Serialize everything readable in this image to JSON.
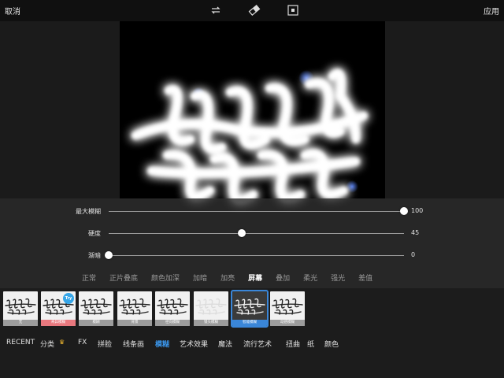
{
  "topbar": {
    "cancel": "取消",
    "apply": "应用",
    "icons": [
      "swap-icon",
      "eraser-icon",
      "compare-icon"
    ]
  },
  "sliders": [
    {
      "label": "最大模糊",
      "value": "100",
      "fraction": 1.0
    },
    {
      "label": "硬度",
      "value": "45",
      "fraction": 0.45
    },
    {
      "label": "渐暗",
      "value": "0",
      "fraction": 0.0
    }
  ],
  "blend_modes": [
    "正常",
    "正片叠底",
    "颜色加深",
    "加暗",
    "加亮",
    "屏幕",
    "叠加",
    "柔光",
    "强光",
    "差值"
  ],
  "blend_active": "屏幕",
  "thumbnails": [
    {
      "caption": "无"
    },
    {
      "caption": "奇异模糊",
      "badge": "Try"
    },
    {
      "caption": "模糊"
    },
    {
      "caption": "背景"
    },
    {
      "caption": "径向模糊"
    },
    {
      "caption": "镜头模糊"
    },
    {
      "caption": "智能模糊"
    },
    {
      "caption": "动感模糊"
    }
  ],
  "selected_thumbnail": "智能模糊",
  "categories": [
    "RECENT",
    "分类",
    "FX",
    "拼脸",
    "线条画",
    "模糊",
    "艺术效果",
    "魔法",
    "流行艺术",
    "扭曲",
    "纸",
    "颜色"
  ],
  "active_category": "模糊",
  "colors": {
    "accent": "#3a86d8",
    "pink": "#e8787e",
    "try_badge": "#36a6e8"
  }
}
